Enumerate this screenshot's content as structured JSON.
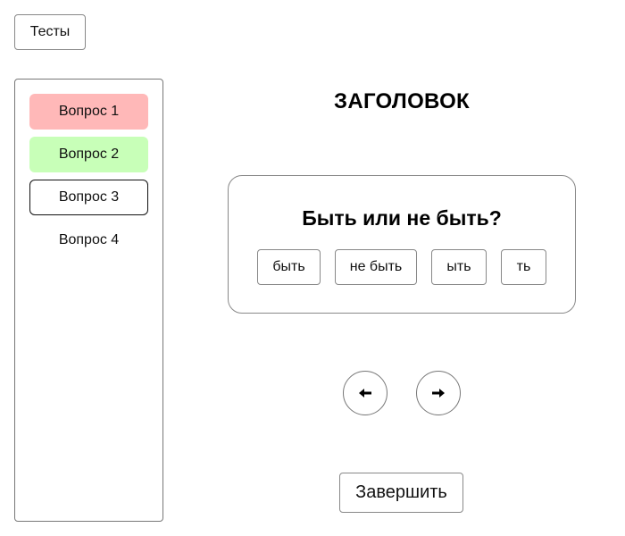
{
  "header": {
    "tests_label": "Тесты"
  },
  "sidebar": {
    "items": [
      {
        "label": "Вопрос 1",
        "status": "incorrect",
        "color": "#ffb8b8"
      },
      {
        "label": "Вопрос 2",
        "status": "correct",
        "color": "#c8ffb8"
      },
      {
        "label": "Вопрос 3",
        "status": "current"
      },
      {
        "label": "Вопрос 4",
        "status": "unanswered"
      }
    ]
  },
  "main": {
    "heading": "ЗАГОЛОВОК",
    "question": "Быть или не быть?",
    "options": [
      "быть",
      "не быть",
      "ыть",
      "ть"
    ],
    "nav": {
      "prev_icon": "arrow-left-icon",
      "next_icon": "arrow-right-icon"
    },
    "finish_label": "Завершить"
  }
}
